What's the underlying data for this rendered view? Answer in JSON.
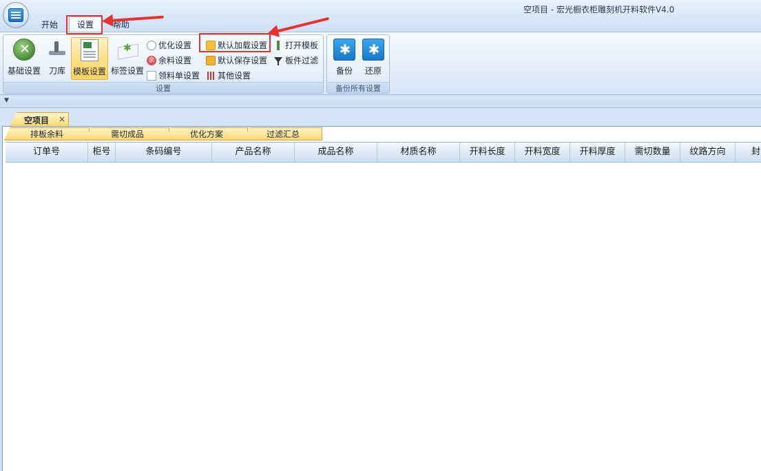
{
  "window": {
    "title": "空项目 - 宏光橱衣柜雕刻机开料软件V4.0"
  },
  "ribbon_tabs": [
    {
      "label": "开始"
    },
    {
      "label": "设置"
    },
    {
      "label": "帮助"
    }
  ],
  "settings_group": {
    "caption": "设置",
    "large_buttons": [
      {
        "label": "基础设置",
        "icon": "wrench-screwdriver-icon"
      },
      {
        "label": "刀库",
        "icon": "knife-icon"
      },
      {
        "label": "模板设置",
        "icon": "template-icon"
      },
      {
        "label": "标签设置",
        "icon": "label-icon"
      }
    ],
    "small_buttons": [
      {
        "label": "优化设置",
        "icon": "clock-icon"
      },
      {
        "label": "余料设置",
        "icon": "remnant-icon"
      },
      {
        "label": "领料单设置",
        "icon": "document-icon"
      },
      {
        "label": "默认加载设置",
        "icon": "folder-open-icon"
      },
      {
        "label": "默认保存设置",
        "icon": "folder-save-icon"
      },
      {
        "label": "其他设置",
        "icon": "sliders-icon"
      },
      {
        "label": "打开模板",
        "icon": "pin-icon"
      },
      {
        "label": "板件过滤",
        "icon": "funnel-icon"
      }
    ]
  },
  "backup_group": {
    "caption": "备份所有设置",
    "buttons": [
      {
        "label": "备份",
        "icon": "gear-backup-icon"
      },
      {
        "label": "还原",
        "icon": "gear-restore-icon"
      }
    ]
  },
  "quick_access": {
    "icon": "collapse-arrow-icon"
  },
  "document_tab": {
    "label": "空项目",
    "close": "×"
  },
  "sub_tabs": [
    {
      "label": "排板余料"
    },
    {
      "label": "需切成品"
    },
    {
      "label": "优化方案"
    },
    {
      "label": "过滤汇总"
    }
  ],
  "grid": {
    "columns": [
      "订单号",
      "柜号",
      "条码编号",
      "产品名称",
      "成品名称",
      "材质名称",
      "开料长度",
      "开料宽度",
      "开料厚度",
      "需切数量",
      "纹路方向",
      "封"
    ]
  },
  "accent_colors": {
    "highlight_red": "#e8322e",
    "active_yellow": "#ffd35c",
    "ribbon_blue": "#cfe0f4"
  }
}
